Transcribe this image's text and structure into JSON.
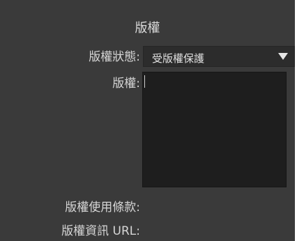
{
  "panel": {
    "title": "版權",
    "copyright_status": {
      "label": "版權狀態:",
      "selected_value": "受版權保護"
    },
    "copyright": {
      "label": "版權:",
      "value": ""
    },
    "usage_terms": {
      "label": "版權使用條款:"
    },
    "copyright_info_url": {
      "label": "版權資訊 URL:"
    }
  },
  "icons": {
    "dropdown": "triangle-down-icon"
  },
  "colors": {
    "panel_bg": "#3a3a3a",
    "field_bg": "#1e1e1e",
    "select_bg": "#2c2c2c",
    "text": "#d6d6d6"
  }
}
